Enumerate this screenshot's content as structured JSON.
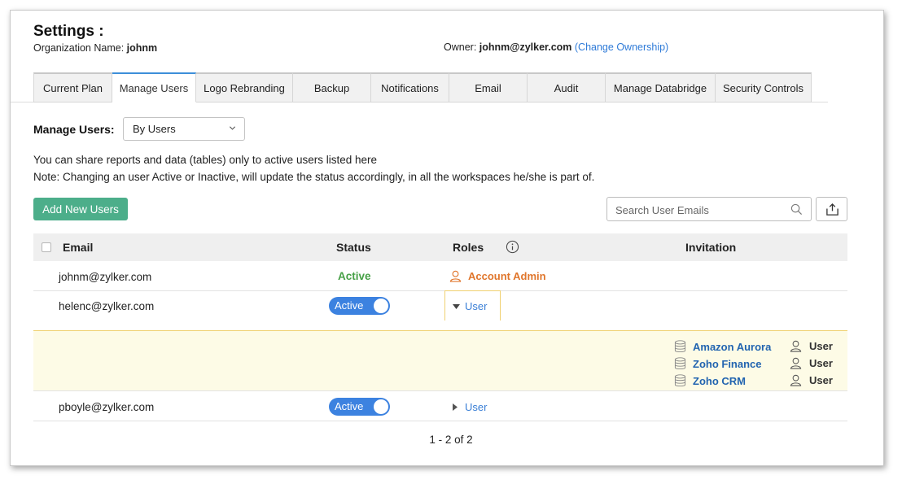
{
  "header": {
    "title": "Settings :",
    "org_label": "Organization Name:",
    "org_value": "johnm",
    "owner_label": "Owner:",
    "owner_value": "johnm@zylker.com",
    "change_ownership": "(Change Ownership)"
  },
  "tabs": [
    {
      "label": "Current Plan"
    },
    {
      "label": "Manage Users"
    },
    {
      "label": "Logo Rebranding"
    },
    {
      "label": "Backup"
    },
    {
      "label": "Notifications"
    },
    {
      "label": "Email"
    },
    {
      "label": "Audit"
    },
    {
      "label": "Manage Databridge"
    },
    {
      "label": "Security Controls"
    }
  ],
  "active_tab": "Manage Users",
  "manage_users": {
    "label": "Manage Users:",
    "selected": "By Users"
  },
  "notes": {
    "line1": "You can share reports and data (tables) only to active users listed here",
    "line2": "Note: Changing an user Active or Inactive, will update the status accordingly, in all the workspaces he/she is part of."
  },
  "toolbar": {
    "add_label": "Add New Users",
    "search_placeholder": "Search User Emails"
  },
  "table": {
    "headers": {
      "email": "Email",
      "status": "Status",
      "roles": "Roles",
      "invitation": "Invitation"
    },
    "rows": [
      {
        "email": "johnm@zylker.com",
        "status": "Active",
        "role": "Account Admin"
      },
      {
        "email": "helenc@zylker.com",
        "status": "Active",
        "role": "User",
        "workspaces": [
          {
            "name": "Amazon Aurora",
            "role": "User"
          },
          {
            "name": "Zoho Finance",
            "role": "User"
          },
          {
            "name": "Zoho CRM",
            "role": "User"
          }
        ]
      },
      {
        "email": "pboyle@zylker.com",
        "status": "Active",
        "role": "User"
      }
    ]
  },
  "pagination": "1 - 2 of 2",
  "colors": {
    "accent": "#3c82e0",
    "add_button": "#4cae8a",
    "active_text": "#46a046",
    "admin_role": "#e0762c",
    "expand_bg": "#fdfbe6"
  }
}
